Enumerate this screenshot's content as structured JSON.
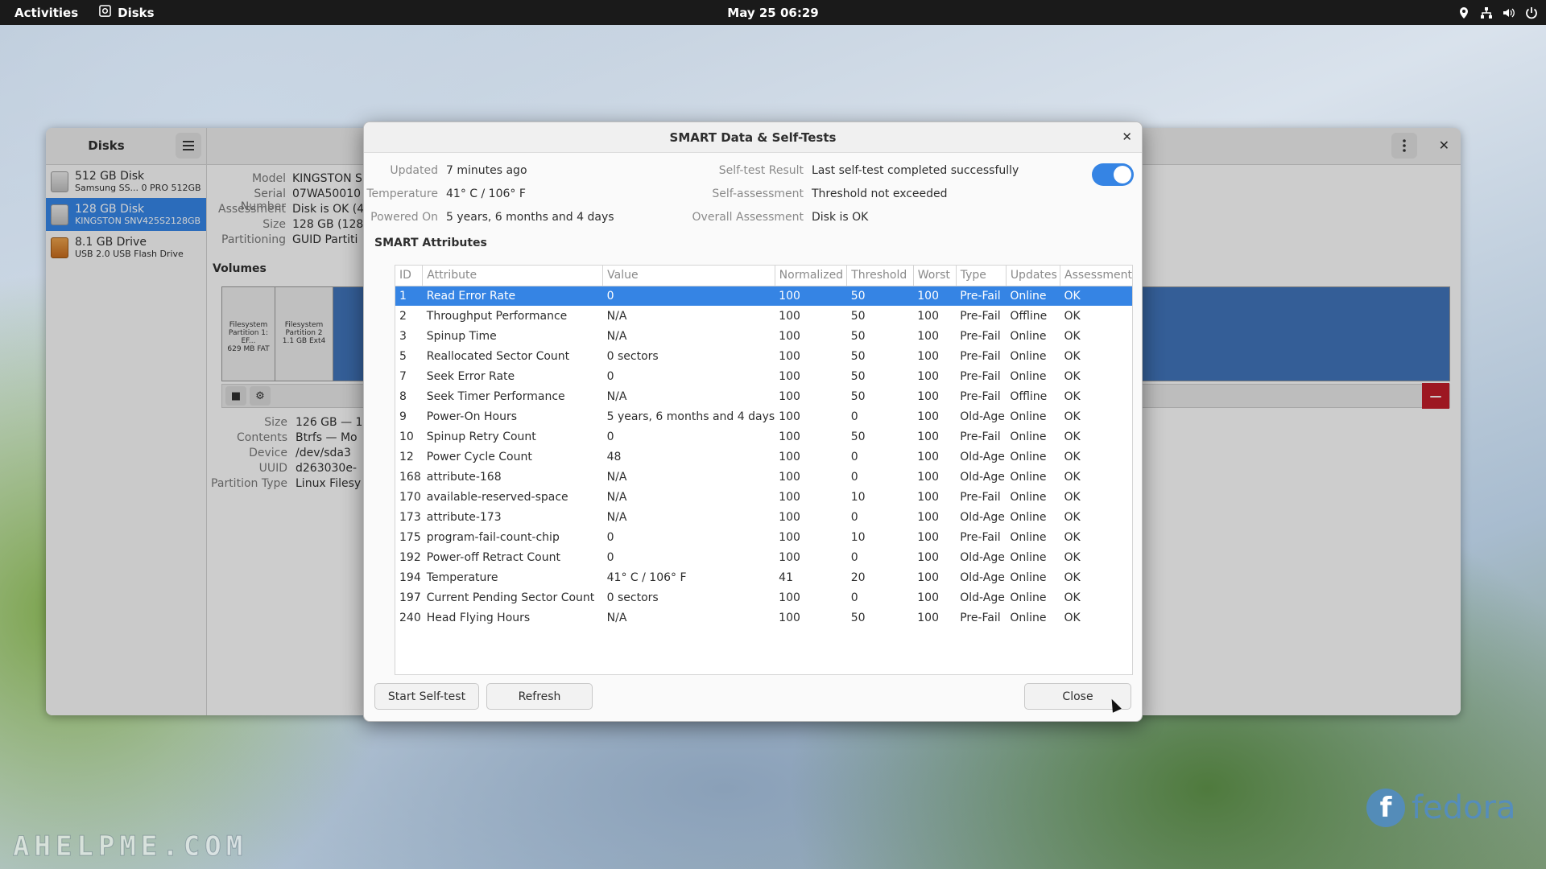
{
  "topbar": {
    "activities": "Activities",
    "app_name": "Disks",
    "clock": "May 25  06:29"
  },
  "disks_window": {
    "title": "Disks",
    "drives": [
      {
        "name": "512 GB Disk",
        "sub": "Samsung SS...  0 PRO 512GB",
        "selected": false
      },
      {
        "name": "128 GB Disk",
        "sub": "KINGSTON SNV425S2128GB",
        "selected": true
      },
      {
        "name": "8.1 GB Drive",
        "sub": "USB 2.0 USB Flash Drive",
        "selected": false
      }
    ],
    "info": [
      {
        "k": "Model",
        "v": "KINGSTON S"
      },
      {
        "k": "Serial Number",
        "v": "07WA50010"
      },
      {
        "k": "Assessment",
        "v": "Disk is OK (4"
      },
      {
        "k": "Size",
        "v": "128 GB (128,"
      },
      {
        "k": "Partitioning",
        "v": "GUID Partiti"
      }
    ],
    "volumes_title": "Volumes",
    "partitions": [
      {
        "line1": "Filesystem",
        "line2": "Partition 1: EF...",
        "line3": "629 MB FAT"
      },
      {
        "line1": "Filesystem",
        "line2": "Partition 2",
        "line3": "1.1 GB Ext4"
      }
    ],
    "volume_info": [
      {
        "k": "Size",
        "v": "126 GB — 1"
      },
      {
        "k": "Contents",
        "v": "Btrfs — Mo"
      },
      {
        "k": "Device",
        "v": "/dev/sda3"
      },
      {
        "k": "UUID",
        "v": "d263030e-"
      },
      {
        "k": "Partition Type",
        "v": "Linux Filesy"
      }
    ]
  },
  "dialog": {
    "title": "SMART Data & Self-Tests",
    "updated_label": "Updated",
    "updated_value": "7 minutes ago",
    "temperature_label": "Temperature",
    "temperature_value": "41° C / 106° F",
    "powered_on_label": "Powered On",
    "powered_on_value": "5 years, 6 months and 4 days",
    "selftest_label": "Self-test Result",
    "selftest_value": "Last self-test completed successfully",
    "selfassess_label": "Self-assessment",
    "selfassess_value": "Threshold not exceeded",
    "overall_label": "Overall Assessment",
    "overall_value": "Disk is OK",
    "smart_enabled": true,
    "section_title": "SMART Attributes",
    "columns": [
      "ID",
      "Attribute",
      "Value",
      "Normalized",
      "Threshold",
      "Worst",
      "Type",
      "Updates",
      "Assessment"
    ],
    "rows": [
      [
        "1",
        "Read Error Rate",
        "0",
        "100",
        "50",
        "100",
        "Pre-Fail",
        "Online",
        "OK"
      ],
      [
        "2",
        "Throughput Performance",
        "N/A",
        "100",
        "50",
        "100",
        "Pre-Fail",
        "Offline",
        "OK"
      ],
      [
        "3",
        "Spinup Time",
        "N/A",
        "100",
        "50",
        "100",
        "Pre-Fail",
        "Online",
        "OK"
      ],
      [
        "5",
        "Reallocated Sector Count",
        "0 sectors",
        "100",
        "50",
        "100",
        "Pre-Fail",
        "Online",
        "OK"
      ],
      [
        "7",
        "Seek Error Rate",
        "0",
        "100",
        "50",
        "100",
        "Pre-Fail",
        "Online",
        "OK"
      ],
      [
        "8",
        "Seek Timer Performance",
        "N/A",
        "100",
        "50",
        "100",
        "Pre-Fail",
        "Offline",
        "OK"
      ],
      [
        "9",
        "Power-On Hours",
        "5 years, 6 months and 4 days",
        "100",
        "0",
        "100",
        "Old-Age",
        "Online",
        "OK"
      ],
      [
        "10",
        "Spinup Retry Count",
        "0",
        "100",
        "50",
        "100",
        "Pre-Fail",
        "Online",
        "OK"
      ],
      [
        "12",
        "Power Cycle Count",
        "48",
        "100",
        "0",
        "100",
        "Old-Age",
        "Online",
        "OK"
      ],
      [
        "168",
        "attribute-168",
        "N/A",
        "100",
        "0",
        "100",
        "Old-Age",
        "Online",
        "OK"
      ],
      [
        "170",
        "available-reserved-space",
        "N/A",
        "100",
        "10",
        "100",
        "Pre-Fail",
        "Online",
        "OK"
      ],
      [
        "173",
        "attribute-173",
        "N/A",
        "100",
        "0",
        "100",
        "Old-Age",
        "Online",
        "OK"
      ],
      [
        "175",
        "program-fail-count-chip",
        "0",
        "100",
        "10",
        "100",
        "Pre-Fail",
        "Online",
        "OK"
      ],
      [
        "192",
        "Power-off Retract Count",
        "0",
        "100",
        "0",
        "100",
        "Old-Age",
        "Online",
        "OK"
      ],
      [
        "194",
        "Temperature",
        "41° C / 106° F",
        "41",
        "20",
        "100",
        "Old-Age",
        "Online",
        "OK"
      ],
      [
        "197",
        "Current Pending Sector Count",
        "0 sectors",
        "100",
        "0",
        "100",
        "Old-Age",
        "Online",
        "OK"
      ],
      [
        "240",
        "Head Flying Hours",
        "N/A",
        "100",
        "50",
        "100",
        "Pre-Fail",
        "Online",
        "OK"
      ]
    ],
    "selected_row": 0,
    "start_selftest_label": "Start Self-test",
    "refresh_label": "Refresh",
    "close_label": "Close"
  },
  "watermark": "AHELPME.COM",
  "brand": "fedora",
  "colors": {
    "accent": "#3584e4",
    "danger": "#c01c28"
  }
}
